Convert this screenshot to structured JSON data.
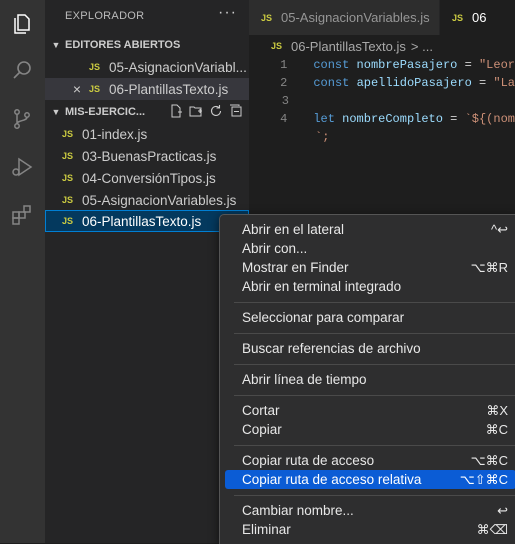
{
  "sidebar": {
    "title": "EXPLORADOR",
    "more": "···",
    "open_editors": {
      "header": "EDITORES ABIERTOS",
      "items": [
        {
          "badge": "JS",
          "label": "05-AsignacionVariabl..."
        },
        {
          "badge": "JS",
          "label": "06-PlantillasTexto.js",
          "close": "×"
        }
      ]
    },
    "workspace": {
      "header": "MIS-EJERCIC...",
      "files": [
        {
          "badge": "JS",
          "label": "01-index.js"
        },
        {
          "badge": "JS",
          "label": "03-BuenasPracticas.js"
        },
        {
          "badge": "JS",
          "label": "04-ConversiónTipos.js"
        },
        {
          "badge": "JS",
          "label": "05-AsignacionVariables.js"
        },
        {
          "badge": "JS",
          "label": "06-PlantillasTexto.js"
        }
      ]
    }
  },
  "editor": {
    "tabs": [
      {
        "badge": "JS",
        "label": "05-AsignacionVariables.js"
      },
      {
        "badge": "JS",
        "label": "06"
      }
    ],
    "breadcrumb": {
      "badge": "JS",
      "file": "06-PlantillasTexto.js",
      "rest": "> ..."
    },
    "lines": [
      {
        "num": "1",
        "kw": "const",
        "name": "nombrePasajero",
        "eq": "=",
        "str": "\"Leor"
      },
      {
        "num": "2",
        "kw": "const",
        "name": "apellidoPasajero",
        "eq": "=",
        "str": "\"La"
      },
      {
        "num": "3"
      },
      {
        "num": "4",
        "kw": "let",
        "name": "nombreCompleto",
        "eq": "=",
        "str": "`${(nom"
      },
      {
        "num": "",
        "cont": "`;"
      }
    ]
  },
  "menu": {
    "items": [
      {
        "label": "Abrir en el lateral",
        "kb": "^↩"
      },
      {
        "label": "Abrir con...",
        "kb": ""
      },
      {
        "label": "Mostrar en Finder",
        "kb": "⌥⌘R"
      },
      {
        "label": "Abrir en terminal integrado",
        "kb": ""
      },
      {
        "label": "Seleccionar para comparar",
        "kb": ""
      },
      {
        "label": "Buscar referencias de archivo",
        "kb": ""
      },
      {
        "label": "Abrir línea de tiempo",
        "kb": ""
      },
      {
        "label": "Cortar",
        "kb": "⌘X"
      },
      {
        "label": "Copiar",
        "kb": "⌘C"
      },
      {
        "label": "Copiar ruta de acceso",
        "kb": "⌥⌘C"
      },
      {
        "label": "Copiar ruta de acceso relativa",
        "kb": "⌥⇧⌘C"
      },
      {
        "label": "Cambiar nombre...",
        "kb": "↩"
      },
      {
        "label": "Eliminar",
        "kb": "⌘⌫"
      }
    ]
  },
  "icons": {
    "explorer": "files-icon",
    "search": "search-icon",
    "scm": "source-control-icon",
    "debug": "run-debug-icon",
    "extensions": "extensions-icon"
  },
  "colors": {
    "accent": "#0b5cd5",
    "js_badge": "#cbcb41",
    "selection": "#04395e"
  }
}
